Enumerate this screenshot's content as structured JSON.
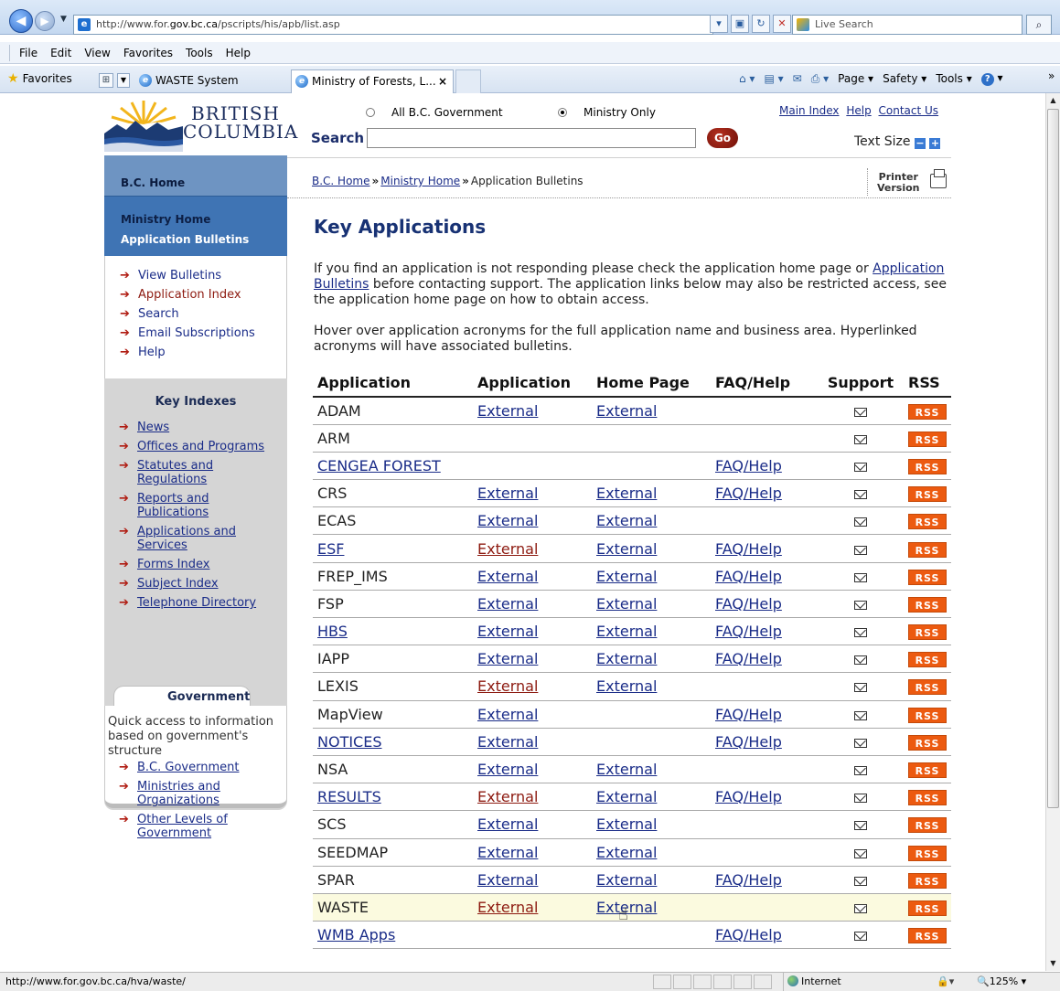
{
  "browser": {
    "address": "http://www.for.gov.bc.ca/pscripts/his/apb/list.asp",
    "address_prefix": "http://www.for.",
    "address_domain": "gov.bc.ca",
    "address_suffix": "/pscripts/his/apb/list.asp",
    "search_placeholder": "Live Search",
    "menu": [
      "File",
      "Edit",
      "View",
      "Favorites",
      "Tools",
      "Help"
    ],
    "favorites_label": "Favorites",
    "tabs": [
      "WASTE System",
      "Ministry of Forests, L..."
    ],
    "commands": [
      "Page",
      "Safety",
      "Tools"
    ],
    "status_url": "http://www.for.gov.bc.ca/hva/waste/",
    "zone": "Internet",
    "zoom": "125%"
  },
  "header": {
    "logo_line1": "BRITISH",
    "logo_line2": "COLUMBIA",
    "scope_all": "All B.C. Government",
    "scope_ministry": "Ministry Only",
    "scope_selected": "Ministry Only",
    "search_label": "Search",
    "search_value": "",
    "go_label": "Go",
    "links": [
      "Main Index",
      "Help",
      "Contact Us"
    ],
    "text_size_label": "Text Size",
    "text_size_minus": "−",
    "text_size_plus": "+"
  },
  "sidebar": {
    "bc_home": "B.C. Home",
    "ministry_home": "Ministry Home",
    "app_bulletins": "Application Bulletins",
    "nav": [
      "View Bulletins",
      "Application Index",
      "Search",
      "Email Subscriptions",
      "Help"
    ],
    "key_indexes_title": "Key Indexes",
    "key_indexes": [
      "News",
      "Offices and Programs",
      "Statutes and Regulations",
      "Reports and Publications",
      "Applications and Services",
      "Forms Index",
      "Subject Index",
      "Telephone Directory"
    ],
    "government_title": "Government",
    "government_desc": "Quick access to information based on government's structure",
    "government_links": [
      "B.C. Government",
      "Ministries and Organizations",
      "Other Levels of Government"
    ]
  },
  "breadcrumb": {
    "items": [
      "B.C. Home",
      "Ministry Home",
      "Application Bulletins"
    ]
  },
  "printer_label_1": "Printer",
  "printer_label_2": "Version",
  "main": {
    "title": "Key Applications",
    "para1_a": "If you find an application is not responding please check the application home page or",
    "para1_link": "Application Bulletins",
    "para1_b": "before contacting support.  The application links below may also be restricted access, see the application home page on how to obtain access.",
    "para2": "Hover over application acronyms for the full application name and business area.  Hyperlinked acronyms will have associated bulletins.",
    "columns": [
      "Application",
      "Application",
      "Home Page",
      "FAQ/Help",
      "Support",
      "RSS"
    ],
    "rss_label": "RSS",
    "rows": [
      {
        "name": "ADAM",
        "linked": false,
        "app": "External",
        "app_visited": false,
        "home": "External",
        "faq": ""
      },
      {
        "name": "ARM",
        "linked": false,
        "app": "",
        "app_visited": false,
        "home": "",
        "faq": ""
      },
      {
        "name": "CENGEA FOREST",
        "linked": true,
        "app": "",
        "app_visited": false,
        "home": "",
        "faq": "FAQ/Help"
      },
      {
        "name": "CRS",
        "linked": false,
        "app": "External",
        "app_visited": false,
        "home": "External",
        "faq": "FAQ/Help"
      },
      {
        "name": "ECAS",
        "linked": false,
        "app": "External",
        "app_visited": false,
        "home": "External",
        "faq": ""
      },
      {
        "name": "ESF",
        "linked": true,
        "app": "External",
        "app_visited": true,
        "home": "External",
        "faq": "FAQ/Help"
      },
      {
        "name": "FREP_IMS",
        "linked": false,
        "app": "External",
        "app_visited": false,
        "home": "External",
        "faq": "FAQ/Help"
      },
      {
        "name": "FSP",
        "linked": false,
        "app": "External",
        "app_visited": false,
        "home": "External",
        "faq": "FAQ/Help"
      },
      {
        "name": "HBS",
        "linked": true,
        "app": "External",
        "app_visited": false,
        "home": "External",
        "faq": "FAQ/Help"
      },
      {
        "name": "IAPP",
        "linked": false,
        "app": "External",
        "app_visited": false,
        "home": "External",
        "faq": "FAQ/Help"
      },
      {
        "name": "LEXIS",
        "linked": false,
        "app": "External",
        "app_visited": true,
        "home": "External",
        "faq": ""
      },
      {
        "name": "MapView",
        "linked": false,
        "app": "External",
        "app_visited": false,
        "home": "",
        "faq": "FAQ/Help"
      },
      {
        "name": "NOTICES",
        "linked": true,
        "app": "External",
        "app_visited": false,
        "home": "",
        "faq": "FAQ/Help"
      },
      {
        "name": "NSA",
        "linked": false,
        "app": "External",
        "app_visited": false,
        "home": "External",
        "faq": ""
      },
      {
        "name": "RESULTS",
        "linked": true,
        "app": "External",
        "app_visited": true,
        "home": "External",
        "faq": "FAQ/Help"
      },
      {
        "name": "SCS",
        "linked": false,
        "app": "External",
        "app_visited": false,
        "home": "External",
        "faq": ""
      },
      {
        "name": "SEEDMAP",
        "linked": false,
        "app": "External",
        "app_visited": false,
        "home": "External",
        "faq": ""
      },
      {
        "name": "SPAR",
        "linked": false,
        "app": "External",
        "app_visited": false,
        "home": "External",
        "faq": "FAQ/Help"
      },
      {
        "name": "WASTE",
        "linked": false,
        "app": "External",
        "app_visited": true,
        "home": "External",
        "faq": "",
        "hovered": true
      },
      {
        "name": "WMB Apps",
        "linked": true,
        "app": "",
        "app_visited": false,
        "home": "",
        "faq": "FAQ/Help"
      }
    ]
  },
  "colors": {
    "link": "#1a2c88",
    "visited": "#8d1a10",
    "rss": "#ec5a10",
    "sidebar_blue": "#3f74b4",
    "heading": "#183274"
  }
}
